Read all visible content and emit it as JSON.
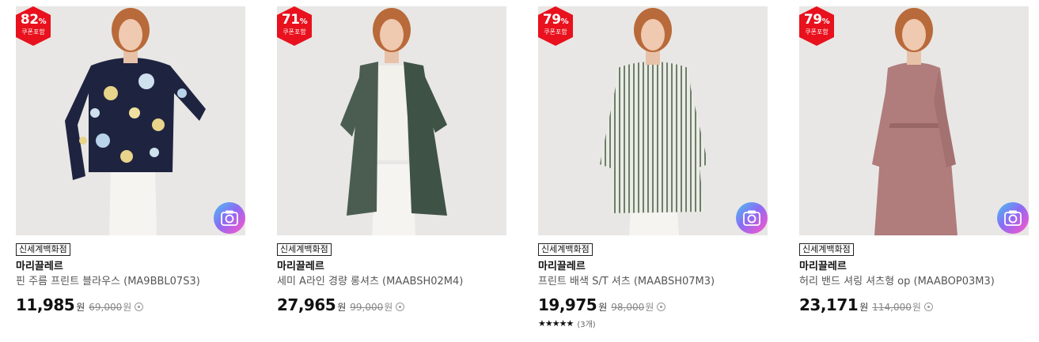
{
  "products": [
    {
      "badge_percent": "82",
      "badge_label": "쿠폰포함",
      "store": "신세계백화점",
      "brand": "마리끌레르",
      "name": "핀 주름 프린트 블라우스 (MA9BBL07S3)",
      "price": "11,985",
      "currency": "원",
      "original_price": "69,000",
      "outfit": "floral blouse navy"
    },
    {
      "badge_percent": "71",
      "badge_label": "쿠폰포함",
      "store": "신세계백화점",
      "brand": "마리끌레르",
      "name": "세미 A라인 경량 롱셔츠 (MAABSH02M4)",
      "price": "27,965",
      "currency": "원",
      "original_price": "99,000",
      "outfit": "dark green long shirt"
    },
    {
      "badge_percent": "79",
      "badge_label": "쿠폰포함",
      "store": "신세계백화점",
      "brand": "마리끌레르",
      "name": "프린트 배색 S/T 셔츠 (MAABSH07M3)",
      "price": "19,975",
      "currency": "원",
      "original_price": "98,000",
      "stars": "★★★★★",
      "review_count": "(3개)",
      "outfit": "striped shirt"
    },
    {
      "badge_percent": "79",
      "badge_label": "쿠폰포함",
      "store": "신세계백화점",
      "brand": "마리끌레르",
      "name": "허리 밴드 셔링 셔츠형 op (MAABOP03M3)",
      "price": "23,171",
      "currency": "원",
      "original_price": "114,000",
      "outfit": "pink shirt dress"
    }
  ],
  "percent_sign": "%",
  "colors": {
    "badge": "#e8111d",
    "accent_text": "#111111"
  }
}
